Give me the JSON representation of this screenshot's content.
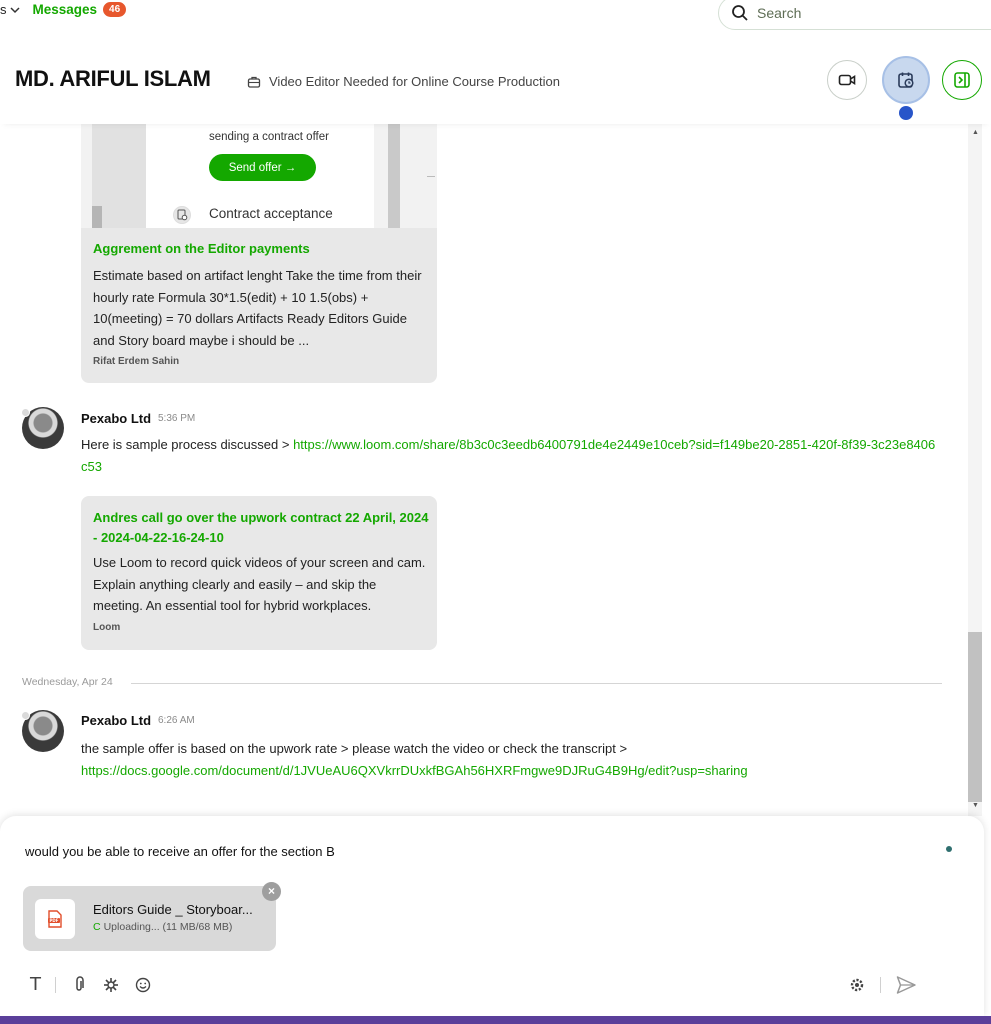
{
  "nav": {
    "left_cut": "s",
    "messages_label": "Messages",
    "messages_count": "46",
    "search_placeholder": "Search"
  },
  "header": {
    "client_name": "MD. ARIFUL ISLAM",
    "job_title": "Video Editor Needed for Online Course Production"
  },
  "card1": {
    "preview_text": "sending a contract offer",
    "preview_button": "Send offer →",
    "preview_step": "Contract acceptance",
    "title": "Aggrement on the Editor payments",
    "body": "Estimate based on artifact lenght Take the time from their hourly rate Formula 30*1.5(edit) + 10 1.5(obs) + 10(meeting) = 70 dollars Artifacts Ready Editors Guide and Story board maybe i should be ...",
    "source": "Rifat Erdem Sahin"
  },
  "message1": {
    "sender": "Pexabo Ltd",
    "time": "5:36 PM",
    "text": "Here is sample process discussed > ",
    "link": "https://www.loom.com/share/8b3c0c3eedb6400791de4e2449e10ceb?sid=f149be20-2851-420f-8f39-3c23e8406c53"
  },
  "card2": {
    "title": "Andres call go over the upwork contract 22 April, 2024 - 2024-04-22-16-24-10",
    "body": "Use Loom to record quick videos of your screen and cam. Explain anything clearly and easily – and skip the meeting. An essential tool for hybrid workplaces.",
    "source": "Loom"
  },
  "date_separator": "Wednesday, Apr 24",
  "message2": {
    "sender": "Pexabo Ltd",
    "time": "6:26 AM",
    "text": "the sample offer is based on the upwork rate > please watch the video or check the transcript > ",
    "link": "https://docs.google.com/document/d/1JVUeAU6QXVkrrDUxkfBGAh56HXRFmgwe9DJRuG4B9Hg/edit?usp=sharing"
  },
  "composer": {
    "draft_text": "would you be able to receive an offer for the section B",
    "attachment_name": "Editors Guide _ Storyboar...",
    "attachment_status": "Uploading... (11 MB/68 MB)",
    "format_label": "T"
  },
  "colors": {
    "brand_green": "#14a800",
    "badge_orange": "#e7572d",
    "highlight_blue": "#2855c9",
    "footer_purple": "#5b3f9a"
  }
}
